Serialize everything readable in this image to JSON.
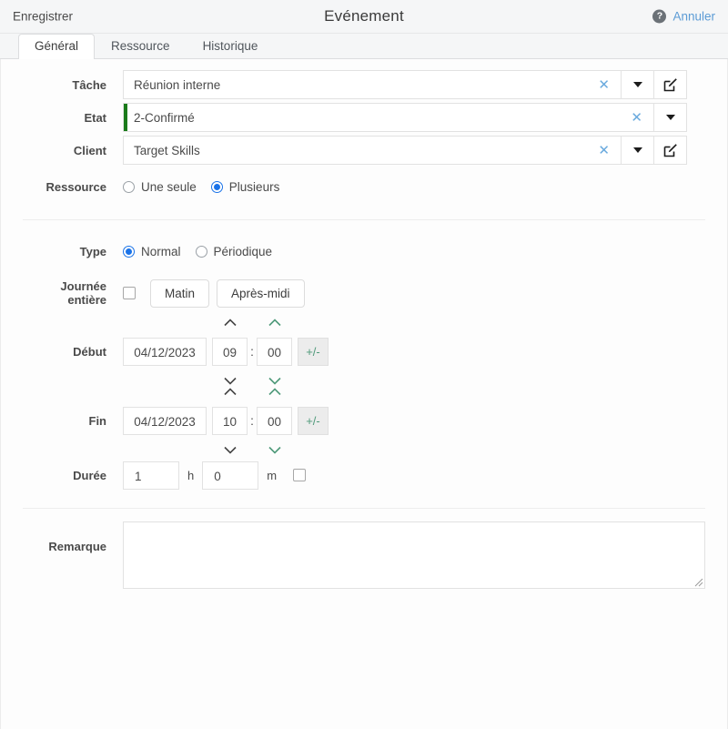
{
  "topbar": {
    "save_label": "Enregistrer",
    "title": "Evénement",
    "help_icon": "help-circle-icon",
    "help_glyph": "?",
    "cancel_label": "Annuler"
  },
  "tabs": [
    {
      "label": "Général",
      "active": true
    },
    {
      "label": "Ressource",
      "active": false
    },
    {
      "label": "Historique",
      "active": false
    }
  ],
  "form": {
    "tache": {
      "label": "Tâche",
      "value": "Réunion interne",
      "clear_glyph": "✕",
      "has_dropdown": true,
      "has_edit": true
    },
    "etat": {
      "label": "Etat",
      "value": "2-Confirmé",
      "clear_glyph": "✕",
      "status_color": "#1a7a1a",
      "has_dropdown": true,
      "has_edit": false
    },
    "client": {
      "label": "Client",
      "value": "Target Skills",
      "clear_glyph": "✕",
      "has_dropdown": true,
      "has_edit": true
    },
    "ressource": {
      "label": "Ressource",
      "options": [
        {
          "label": "Une seule",
          "checked": false
        },
        {
          "label": "Plusieurs",
          "checked": true
        }
      ]
    },
    "type": {
      "label": "Type",
      "options": [
        {
          "label": "Normal",
          "checked": true
        },
        {
          "label": "Périodique",
          "checked": false
        }
      ]
    },
    "journee_entiere": {
      "label": "Journée entière",
      "checked": false,
      "buttons": [
        "Matin",
        "Après-midi"
      ]
    },
    "debut": {
      "label": "Début",
      "date": "04/12/2023",
      "hour": "09",
      "separator": ":",
      "minute": "00",
      "plus_minus_label": "+/-"
    },
    "fin": {
      "label": "Fin",
      "date": "04/12/2023",
      "hour": "10",
      "separator": ":",
      "minute": "00",
      "plus_minus_label": "+/-"
    },
    "duree": {
      "label": "Durée",
      "hours": "1",
      "hours_unit": "h",
      "minutes": "0",
      "minutes_unit": "m",
      "checked": false
    },
    "remarque": {
      "label": "Remarque",
      "value": "",
      "placeholder": ""
    }
  },
  "colors": {
    "accent_blue": "#1a73e8",
    "link_blue": "#5b9bd5",
    "status_green": "#1a7a1a",
    "spinner_green": "#4f9a7a",
    "spinner_gray": "#444444"
  }
}
